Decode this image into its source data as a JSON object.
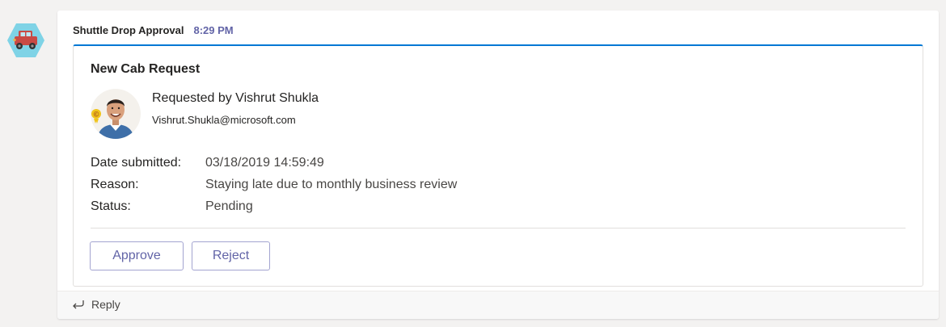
{
  "message": {
    "sender": "Shuttle Drop Approval",
    "time": "8:29 PM",
    "bot_icon": "car-icon"
  },
  "card": {
    "title": "New Cab Request",
    "requester": {
      "name": "Requested by Vishrut Shukla",
      "email": "Vishrut.Shukla@microsoft.com"
    },
    "facts": [
      {
        "label": "Date submitted:",
        "value": "03/18/2019 14:59:49"
      },
      {
        "label": "Reason:",
        "value": "Staying late due to monthly business review"
      },
      {
        "label": "Status:",
        "value": "Pending"
      }
    ],
    "actions": {
      "approve_label": "Approve",
      "reject_label": "Reject"
    }
  },
  "reply": {
    "label": "Reply",
    "icon": "reply-arrow-icon"
  },
  "colors": {
    "accent": "#6264a7",
    "card_top_border": "#0078d4",
    "bot_hexagon": "#7fd3e6",
    "car": "#d9534f"
  }
}
